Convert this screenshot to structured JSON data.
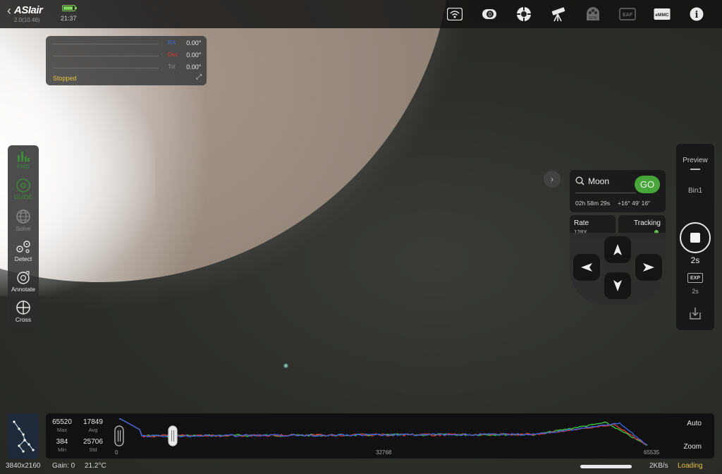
{
  "app": {
    "brand": "ASIair",
    "version": "2.0(10.46)",
    "clock": "21:37",
    "battery_color": "#7fd35c"
  },
  "topbar_icons": [
    {
      "name": "wifi-icon"
    },
    {
      "name": "camera-icon",
      "text": "0"
    },
    {
      "name": "guide-camera-icon"
    },
    {
      "name": "telescope-icon"
    },
    {
      "name": "efw-icon",
      "text": "EFW"
    },
    {
      "name": "eaf-icon",
      "text": "EAF"
    },
    {
      "name": "emmc-icon",
      "text": "eMMC"
    },
    {
      "name": "info-icon",
      "text": "i"
    }
  ],
  "guide": {
    "rows": [
      {
        "label": "RA",
        "label_color": "#3a6fd6",
        "value": "0.00″"
      },
      {
        "label": "Dec",
        "label_color": "#d23b3b",
        "value": "0.00″"
      },
      {
        "label": "Tot",
        "label_color": "#8a8a8a",
        "value": "0.00″"
      }
    ],
    "status": "Stopped",
    "status_color": "#e6c440"
  },
  "left_toolbar": [
    {
      "label": "PHD",
      "icon": "chart-icon",
      "active": true,
      "color": "#3a8c37"
    },
    {
      "label": "GUIDE",
      "icon": "target-icon",
      "active": true,
      "color": "#3a8c37"
    },
    {
      "label": "Solve",
      "icon": "globe-icon",
      "active": false,
      "color": "#8a8a8a"
    },
    {
      "label": "Detect",
      "icon": "detect-icon",
      "active": true,
      "color": "#e8e8e8"
    },
    {
      "label": "Annotate",
      "icon": "annotate-icon",
      "active": true,
      "color": "#e8e8e8"
    },
    {
      "label": "Cross",
      "icon": "crosshair-icon",
      "active": true,
      "color": "#e8e8e8"
    }
  ],
  "goto": {
    "target": "Moon",
    "go_label": "GO",
    "go_color": "#47a53a",
    "ra": "02h 58m 29s",
    "dec": "+16° 49′ 16″",
    "rate_label": "Rate",
    "rate_value": "128X",
    "tracking_label": "Tracking",
    "tracking_color": "#5cc44a"
  },
  "right_panel": {
    "mode": "Preview",
    "bin": "Bin1",
    "exposure": "2s",
    "exp_badge": "EXP",
    "exp_value": "2s"
  },
  "histogram": {
    "stats": [
      {
        "value": "65520",
        "caption": "Max"
      },
      {
        "value": "17849",
        "caption": "Avg"
      },
      {
        "value": "384",
        "caption": "Min"
      },
      {
        "value": "25706",
        "caption": "Std"
      }
    ],
    "axis_min": "0",
    "axis_mid": "32768",
    "axis_max": "65535",
    "auto_label": "Auto",
    "zoom_label": "Zoom",
    "low_stretch": 0.12,
    "high_stretch": 0.0,
    "series_colors": [
      "#3cc43a",
      "#d23b3b",
      "#3a62d8"
    ]
  },
  "status": {
    "resolution": "3840x2160",
    "gain": "Gain: 0",
    "temperature": "21.2°C",
    "transfer": "2KB/s",
    "loading": "Loading",
    "loading_color": "#e6c440"
  }
}
